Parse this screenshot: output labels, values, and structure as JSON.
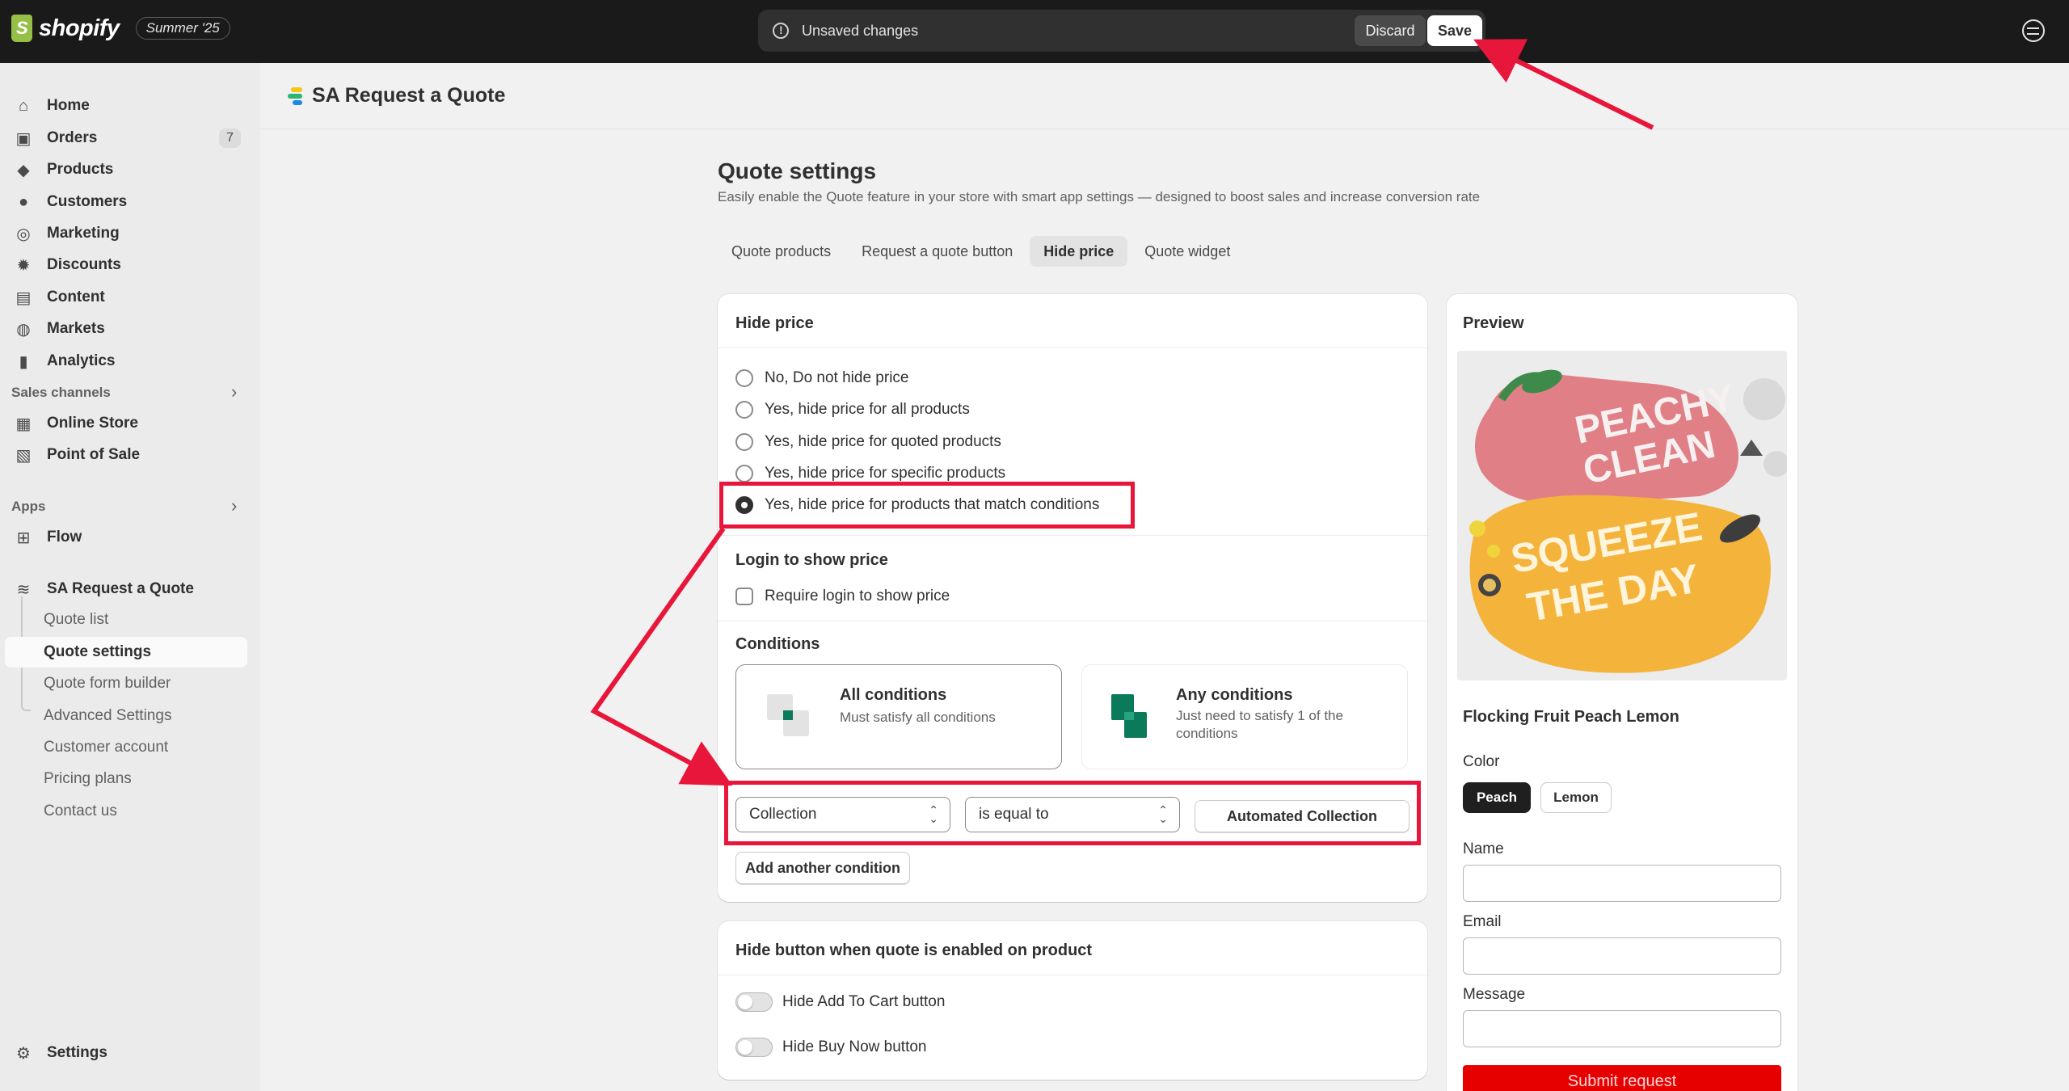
{
  "topbar": {
    "brand": "shopify",
    "edition": "Summer '25",
    "unsaved_text": "Unsaved changes",
    "discard_label": "Discard",
    "save_label": "Save"
  },
  "sidebar": {
    "items": [
      {
        "label": "Home",
        "icon": "home-icon"
      },
      {
        "label": "Orders",
        "icon": "orders-icon",
        "badge": "7"
      },
      {
        "label": "Products",
        "icon": "tag-icon"
      },
      {
        "label": "Customers",
        "icon": "person-icon"
      },
      {
        "label": "Marketing",
        "icon": "target-icon"
      },
      {
        "label": "Discounts",
        "icon": "discount-icon"
      },
      {
        "label": "Content",
        "icon": "content-icon"
      },
      {
        "label": "Markets",
        "icon": "globe-icon"
      },
      {
        "label": "Analytics",
        "icon": "bar-chart-icon"
      }
    ],
    "sales_channels_label": "Sales channels",
    "sales_channels": [
      {
        "label": "Online Store",
        "icon": "store-icon"
      },
      {
        "label": "Point of Sale",
        "icon": "pos-icon"
      }
    ],
    "apps_label": "Apps",
    "apps": [
      {
        "label": "Flow",
        "icon": "flow-icon"
      },
      {
        "label": "SA Request a Quote",
        "icon": "app-quote-icon"
      }
    ],
    "app_subitems": [
      "Quote list",
      "Quote settings",
      "Quote form builder",
      "Advanced Settings",
      "Customer account",
      "Pricing plans",
      "Contact us"
    ],
    "settings_label": "Settings"
  },
  "header": {
    "app_title": "SA Request a Quote"
  },
  "settings": {
    "title": "Quote settings",
    "subtitle": "Easily enable the Quote feature in your store with smart app settings — designed to boost sales and increase conversion rate",
    "tabs": [
      "Quote products",
      "Request a quote button",
      "Hide price",
      "Quote widget"
    ],
    "active_tab": "Hide price"
  },
  "hide_price": {
    "title": "Hide price",
    "options": [
      "No, Do not hide price",
      "Yes, hide price for all products",
      "Yes, hide price for quoted products",
      "Yes, hide price for specific products",
      "Yes, hide price for products that match conditions"
    ],
    "selected_index": 4,
    "login_title": "Login to show price",
    "login_checkbox": "Require login to show price",
    "conditions_title": "Conditions",
    "all_conditions": {
      "name": "All conditions",
      "desc": "Must satisfy all conditions"
    },
    "any_conditions": {
      "name": "Any conditions",
      "desc_line1": "Just need to satisfy 1 of the",
      "desc_line2": "conditions"
    },
    "condition_field": "Collection",
    "condition_operator": "is equal to",
    "condition_value": "Automated Collection",
    "add_condition": "Add another condition"
  },
  "hide_button": {
    "title": "Hide button when quote is enabled on product",
    "toggles": [
      "Hide Add To Cart button",
      "Hide Buy Now button"
    ]
  },
  "preview": {
    "title": "Preview",
    "product_name": "Flocking Fruit Peach Lemon",
    "color_label": "Color",
    "colors": [
      "Peach",
      "Lemon"
    ],
    "rug_text_top_1": "PEACHY",
    "rug_text_top_2": "CLEAN",
    "rug_text_bottom_1": "SQUEEZE",
    "rug_text_bottom_2": "THE DAY",
    "name_label": "Name",
    "email_label": "Email",
    "message_label": "Message",
    "submit_label": "Submit request"
  },
  "colors": {
    "annotation": "#e8163b",
    "topbar_bg": "#1a1a1a",
    "submit_red": "#e60000"
  }
}
